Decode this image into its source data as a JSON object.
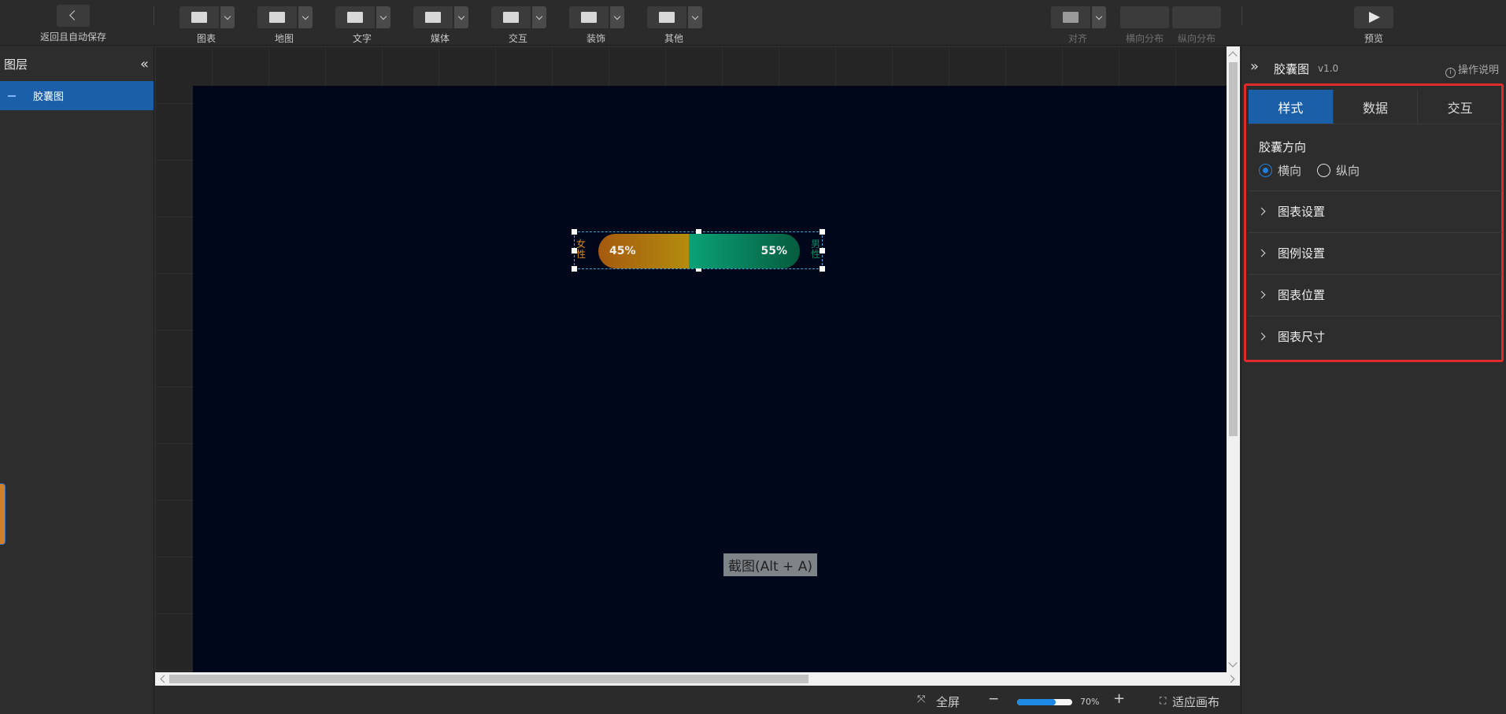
{
  "toolbar": {
    "back_label": "返回且自动保存",
    "groups": [
      {
        "label": "图表",
        "icon": "bar-chart-icon"
      },
      {
        "label": "地图",
        "icon": "map-icon"
      },
      {
        "label": "文字",
        "icon": "text-icon"
      },
      {
        "label": "媒体",
        "icon": "media-icon"
      },
      {
        "label": "交互",
        "icon": "interaction-icon"
      },
      {
        "label": "装饰",
        "icon": "decoration-icon"
      },
      {
        "label": "其他",
        "icon": "more-icon"
      }
    ],
    "align_label": "对齐",
    "hdist_label": "横向分布",
    "vdist_label": "纵向分布",
    "preview_label": "预览"
  },
  "left_panel": {
    "title": "图层",
    "layers": [
      {
        "label": "胶囊图"
      }
    ]
  },
  "canvas": {
    "chart_left_label": "女性",
    "chart_right_label": "男性",
    "female_pct": "45%",
    "male_pct": "55%",
    "screenshot_tooltip": "截图(Alt + A)"
  },
  "chart_data": {
    "type": "bar",
    "categories": [
      "女性",
      "男性"
    ],
    "values": [
      45,
      55
    ],
    "colors": [
      "#b38c0e",
      "#0aa277"
    ]
  },
  "bottom_bar": {
    "fullscreen_label": "全屏",
    "zoom_minus": "−",
    "zoom_plus": "+",
    "zoom_value": "70%",
    "zoom_fraction": 0.7,
    "fit_label": "适应画布"
  },
  "right_panel": {
    "title": "胶囊图",
    "version": "v1.0",
    "help_label": "操作说明",
    "tabs": [
      {
        "label": "样式",
        "active": true
      },
      {
        "label": "数据",
        "active": false
      },
      {
        "label": "交互",
        "active": false
      }
    ],
    "direction_title": "胶囊方向",
    "direction_options": [
      {
        "label": "横向",
        "selected": true
      },
      {
        "label": "纵向",
        "selected": false
      }
    ],
    "sections": [
      {
        "label": "图表设置"
      },
      {
        "label": "图例设置"
      },
      {
        "label": "图表位置"
      },
      {
        "label": "图表尺寸"
      }
    ]
  },
  "colors": {
    "accent": "#1a5fa8",
    "highlight_border": "#e02b2b",
    "stage_bg": "#01071a"
  }
}
